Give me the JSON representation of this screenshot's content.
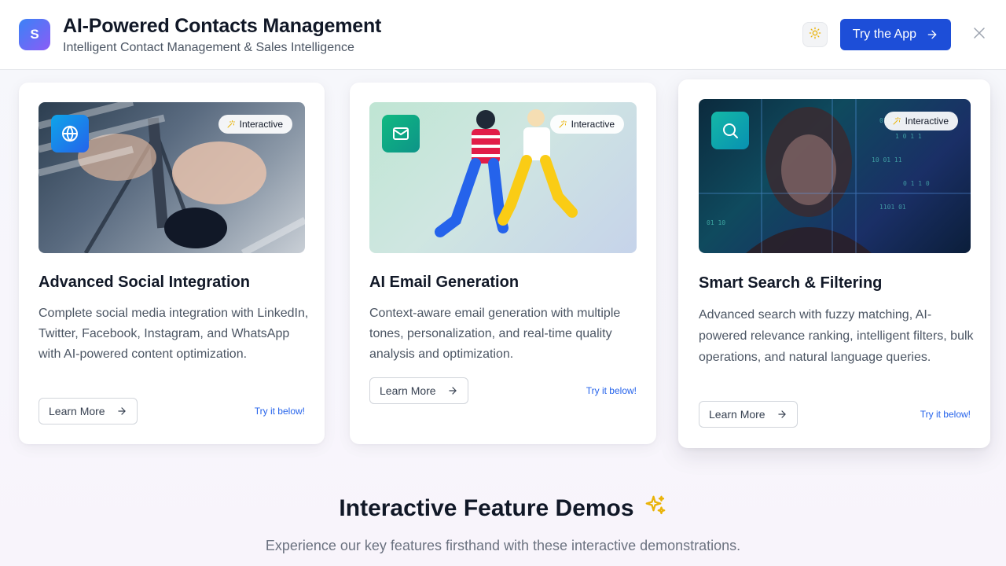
{
  "header": {
    "logo_letter": "S",
    "title": "AI-Powered Contacts Management",
    "subtitle": "Intelligent Contact Management & Sales Intelligence",
    "try_app_label": "Try the App",
    "theme_icon": "sun-icon",
    "close_icon": "close-icon"
  },
  "cards": [
    {
      "title": "Advanced Social Integration",
      "description": "Complete social media integration with LinkedIn, Twitter, Facebook, Instagram, and WhatsApp with AI-powered content optimization.",
      "chip": "Interactive",
      "icon": "globe-icon",
      "learn_more": "Learn More",
      "try_below": "Try it below!"
    },
    {
      "title": "AI Email Generation",
      "description": "Context-aware email generation with multiple tones, personalization, and real-time quality analysis and optimization.",
      "chip": "Interactive",
      "icon": "mail-icon",
      "learn_more": "Learn More",
      "try_below": "Try it below!"
    },
    {
      "title": "Smart Search & Filtering",
      "description": "Advanced search with fuzzy matching, AI-powered relevance ranking, intelligent filters, bulk operations, and natural language queries.",
      "chip": "Interactive",
      "icon": "search-icon",
      "learn_more": "Learn More",
      "try_below": "Try it below!"
    }
  ],
  "section": {
    "title": "Interactive Feature Demos",
    "subtitle": "Experience our key features firsthand with these interactive demonstrations.",
    "icon": "sparkles-icon"
  },
  "colors": {
    "primary": "#1d4ed8",
    "link": "#2563eb",
    "accent_sparkle": "#eab308"
  }
}
